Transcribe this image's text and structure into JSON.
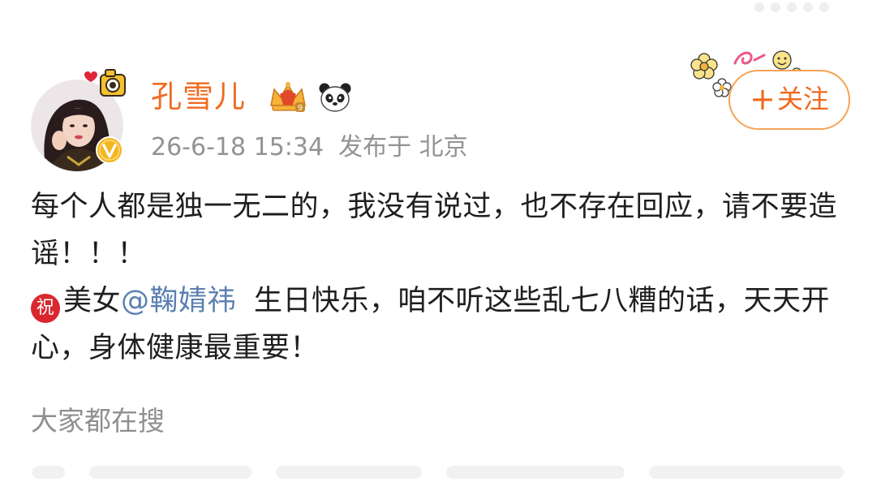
{
  "user": {
    "name": "孔雪儿",
    "crown_badge_text": "9",
    "meta": {
      "datetime": "26-6-18 15:34",
      "location": "发布于 北京"
    }
  },
  "follow": {
    "plus": "+",
    "label": "关注"
  },
  "post": {
    "line1": "每个人都是独一无二的，我没有说过，也不存在回应，请不要造谣！！！",
    "zhu_icon": "祝",
    "line2_prefix": "美女",
    "mention": "@鞠婧祎",
    "line2_suffix": "生日快乐，咱不听这些乱七八糟的话，天天开心，身体健康最重要！"
  },
  "trending": {
    "label": "大家都在搜"
  },
  "colors": {
    "username": "#f06a1f",
    "mention": "#5a7fb0",
    "follow_border": "#f4a455",
    "meta_text": "#939393",
    "body_text": "#1f1f1f"
  },
  "icons": [
    "avatar-pendant-icon",
    "verify-v-icon",
    "crown-badge-icon",
    "panda-icon",
    "flower-decoration-icon",
    "zhu-icon"
  ]
}
